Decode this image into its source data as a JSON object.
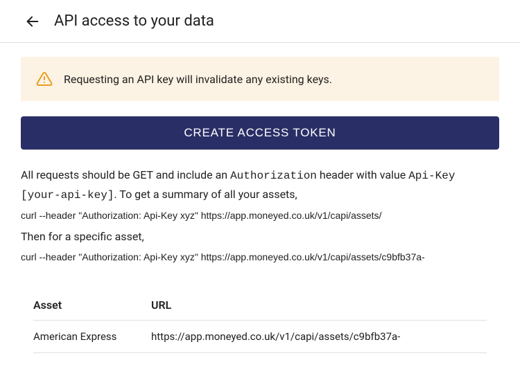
{
  "header": {
    "title": "API access to your data"
  },
  "alert": {
    "text": "Requesting an API key will invalidate any existing keys."
  },
  "button": {
    "create_label": "CREATE ACCESS TOKEN"
  },
  "instructions": {
    "part1": "All requests should be GET and include an ",
    "code1": "Authorization",
    "part2": " header with value ",
    "code2": "Api-Key [your-api-key]",
    "part3": ". To get a summary of all your assets,",
    "curl1": "curl --header \"Authorization: Api-Key xyz\" https://app.moneyed.co.uk/v1/capi/assets/",
    "then": "Then for a specific asset,",
    "curl2": "curl --header \"Authorization: Api-Key xyz\" https://app.moneyed.co.uk/v1/capi/assets/c9bfb37a-"
  },
  "table": {
    "headers": {
      "asset": "Asset",
      "url": "URL"
    },
    "rows": [
      {
        "asset": "American Express",
        "url": "https://app.moneyed.co.uk/v1/capi/assets/c9bfb37a-"
      }
    ]
  }
}
